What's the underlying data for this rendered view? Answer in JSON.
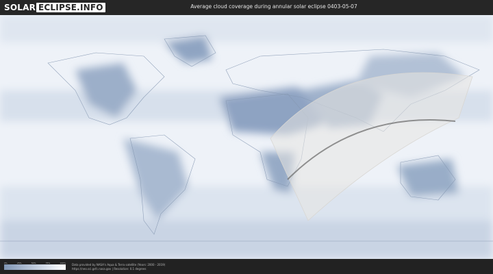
{
  "logo": {
    "part1": "SOLAR",
    "part2": "ECLIPSE.INFO"
  },
  "title": "Average cloud coverage during annular solar eclipse 0403-05-07",
  "legend": {
    "ticks": [
      "0%",
      "25%",
      "50%",
      "75%",
      "100%"
    ],
    "colors": [
      "#8096b4",
      "#ffffff"
    ]
  },
  "credit": {
    "line1": "Data provided by NASA's Aqua & Terra satellite (Years: 2000 - 2019)",
    "line2": "https://neo.sci.gsfc.nasa.gov | Resolution: 0.1 degrees"
  },
  "colors": {
    "clear_sky": "#7f97b8",
    "cloud": "#f2f5f9",
    "eclipse_path": "#e8e6e2",
    "central_line": "#6f6f6f",
    "header_bg": "#262626"
  }
}
